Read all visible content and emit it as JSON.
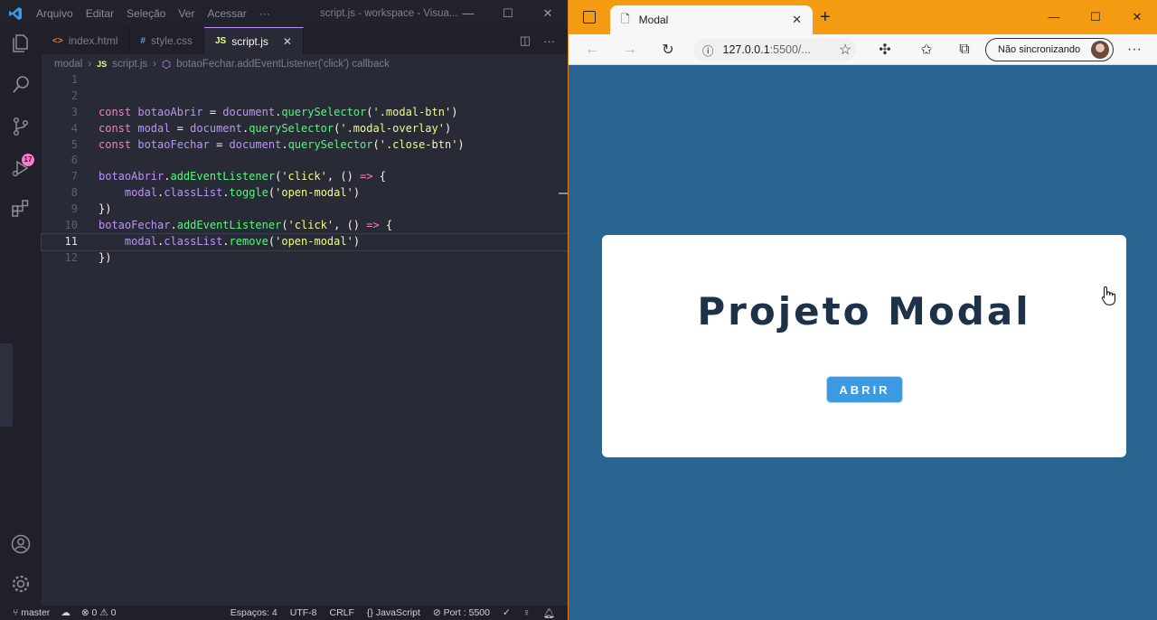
{
  "vscode": {
    "menu": [
      "Arquivo",
      "Editar",
      "Seleção",
      "Ver",
      "Acessar",
      "···"
    ],
    "window_title": "script.js - workspace - Visua...",
    "source_control_badge": "17",
    "tabs": [
      {
        "icon": "<>",
        "label": "index.html",
        "active": false
      },
      {
        "icon": "#",
        "label": "style.css",
        "active": false
      },
      {
        "icon": "JS",
        "label": "script.js",
        "active": true
      }
    ],
    "breadcrumb": [
      "modal",
      "script.js",
      "botaoFechar.addEventListener('click') callback"
    ],
    "line_numbers": [
      "1",
      "2",
      "3",
      "4",
      "5",
      "6",
      "7",
      "8",
      "9",
      "10",
      "11",
      "12"
    ],
    "current_line": 11,
    "status": {
      "branch": "master",
      "errors": "0",
      "warnings": "0",
      "spaces": "Espaços: 4",
      "encoding": "UTF-8",
      "eol": "CRLF",
      "language": "JavaScript",
      "port": "Port : 5500"
    }
  },
  "code_lines": [
    [],
    [],
    [
      [
        "kw",
        "const "
      ],
      [
        "var",
        "botaoAbrir"
      ],
      [
        "plain",
        " = "
      ],
      [
        "var",
        "document"
      ],
      [
        "plain",
        "."
      ],
      [
        "fn",
        "querySelector"
      ],
      [
        "plain",
        "("
      ],
      [
        "str",
        "'.modal-btn'"
      ],
      [
        "plain",
        ")"
      ]
    ],
    [
      [
        "kw",
        "const "
      ],
      [
        "var",
        "modal"
      ],
      [
        "plain",
        " = "
      ],
      [
        "var",
        "document"
      ],
      [
        "plain",
        "."
      ],
      [
        "fn",
        "querySelector"
      ],
      [
        "plain",
        "("
      ],
      [
        "str",
        "'.modal-overlay'"
      ],
      [
        "plain",
        ")"
      ]
    ],
    [
      [
        "kw",
        "const "
      ],
      [
        "var",
        "botaoFechar"
      ],
      [
        "plain",
        " = "
      ],
      [
        "var",
        "document"
      ],
      [
        "plain",
        "."
      ],
      [
        "fn",
        "querySelector"
      ],
      [
        "plain",
        "("
      ],
      [
        "str",
        "'.close-btn'"
      ],
      [
        "plain",
        ")"
      ]
    ],
    [],
    [
      [
        "var",
        "botaoAbrir"
      ],
      [
        "plain",
        "."
      ],
      [
        "fn",
        "addEventListener"
      ],
      [
        "plain",
        "("
      ],
      [
        "str",
        "'click'"
      ],
      [
        "plain",
        ", () "
      ],
      [
        "op",
        "=>"
      ],
      [
        "plain",
        " {"
      ]
    ],
    [
      [
        "plain",
        "    "
      ],
      [
        "var",
        "modal"
      ],
      [
        "plain",
        "."
      ],
      [
        "var",
        "classList"
      ],
      [
        "plain",
        "."
      ],
      [
        "fn",
        "toggle"
      ],
      [
        "plain",
        "("
      ],
      [
        "str",
        "'open-modal'"
      ],
      [
        "plain",
        ")"
      ]
    ],
    [
      [
        "plain",
        "})"
      ]
    ],
    [
      [
        "var",
        "botaoFechar"
      ],
      [
        "plain",
        "."
      ],
      [
        "fn",
        "addEventListener"
      ],
      [
        "plain",
        "("
      ],
      [
        "str",
        "'click'"
      ],
      [
        "plain",
        ", () "
      ],
      [
        "op",
        "=>"
      ],
      [
        "plain",
        " {"
      ]
    ],
    [
      [
        "plain",
        "    "
      ],
      [
        "var",
        "modal"
      ],
      [
        "plain",
        "."
      ],
      [
        "var",
        "classList"
      ],
      [
        "plain",
        "."
      ],
      [
        "fn",
        "remove"
      ],
      [
        "plain",
        "("
      ],
      [
        "str",
        "'open-modal'"
      ],
      [
        "plain",
        ")"
      ]
    ],
    [
      [
        "plain",
        "})"
      ]
    ]
  ],
  "browser": {
    "tab_title": "Modal",
    "address_host": "127.0.0.1",
    "address_rest": ":5500/...",
    "sync_label": "Não sincronizando",
    "page": {
      "title": "Projeto Modal",
      "button_label": "ABRIR",
      "background": "#2a6592",
      "button_color": "#3b9ae1"
    }
  }
}
